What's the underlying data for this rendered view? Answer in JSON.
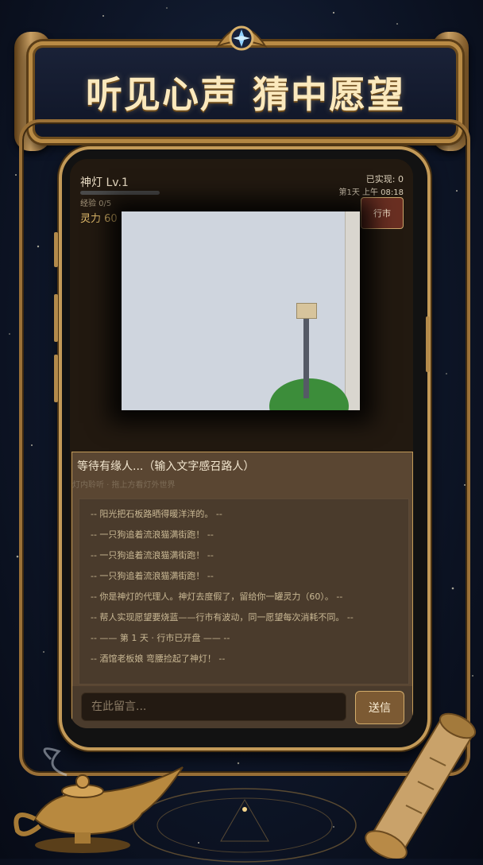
{
  "banner": {
    "title": "听见心声 猜中愿望"
  },
  "status": {
    "lamp_level": "神灯 Lv.1",
    "xp_text": "经验 0/5",
    "xp_fraction": 0,
    "spirit_text": "灵力 60 | 待兑 0",
    "realized": "已实现: 0",
    "day_time": "第1天 上午 08:18",
    "market_button": "行市"
  },
  "chat": {
    "waiting_text": "等待有缘人...（输入文字感召路人）",
    "hint_text": "灯内聆听 · 拖上方看灯外世界",
    "log": [
      "-- 阳光把石板路晒得暖洋洋的。 --",
      "-- 一只狗追着流浪猫满街跑！ --",
      "-- 一只狗追着流浪猫满街跑！ --",
      "-- 一只狗追着流浪猫满街跑！ --",
      "-- 你是神灯的代理人。神灯去度假了，留给你一罐灵力（60）。 --",
      "-- 帮人实现愿望要烧蓝——行市有波动，同一愿望每次消耗不同。 --",
      "-- —— 第 1 天 · 行市已开盘 —— --",
      "-- 酒馆老板娘 弯腰捡起了神灯！ --"
    ],
    "input_placeholder": "在此留言...",
    "send_button": "送信"
  },
  "colors": {
    "gold": "#c39a58",
    "spirit": "#e7c06e",
    "market_bg": "#6a2f22",
    "panel_bg": "#5a4632"
  }
}
